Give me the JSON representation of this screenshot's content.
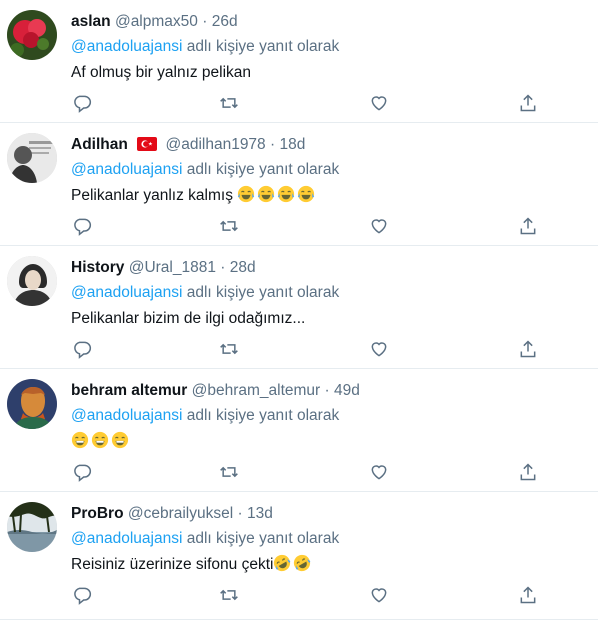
{
  "reply_prefix_suffix": "adlı kişiye yanıt olarak",
  "reply_mention": "@anadoluajansi",
  "colors": {
    "link": "#1da1f2",
    "secondary": "#5b7083",
    "text": "#0f1419",
    "divider": "#e6ecf0"
  },
  "tweets": [
    {
      "name": "aslan",
      "handle": "@alpmax50",
      "sep": "·",
      "time": "26d",
      "text": "Af olmuş bir yalnız pelikan"
    },
    {
      "name": "Adilhan",
      "flag": "turkey-flag-icon",
      "handle": "@adilhan1978",
      "sep": "·",
      "time": "18d",
      "text": "Pelikanlar yanlız kalmış",
      "emojis": [
        "face-with-tears-of-joy",
        "face-with-tears-of-joy",
        "face-with-tears-of-joy",
        "face-with-tears-of-joy"
      ]
    },
    {
      "name": "History",
      "handle": "@Ural_1881",
      "sep": "·",
      "time": "28d",
      "text": "Pelikanlar bizim de ilgi odağımız..."
    },
    {
      "name": "behram altemur",
      "handle": "@behram_altemur",
      "sep": "·",
      "time": "49d",
      "text": "",
      "emojis": [
        "grinning-face-with-smiling-eyes",
        "grinning-face-with-smiling-eyes",
        "grinning-face-with-smiling-eyes"
      ]
    },
    {
      "name": "ProBro",
      "handle": "@cebrailyuksel",
      "sep": "·",
      "time": "13d",
      "text": "Reisiniz üzerinize sifonu çekti",
      "emojis": [
        "rolling-on-the-floor-laughing",
        "rolling-on-the-floor-laughing"
      ]
    }
  ],
  "actions": [
    "reply-icon",
    "retweet-icon",
    "like-icon",
    "share-icon"
  ]
}
